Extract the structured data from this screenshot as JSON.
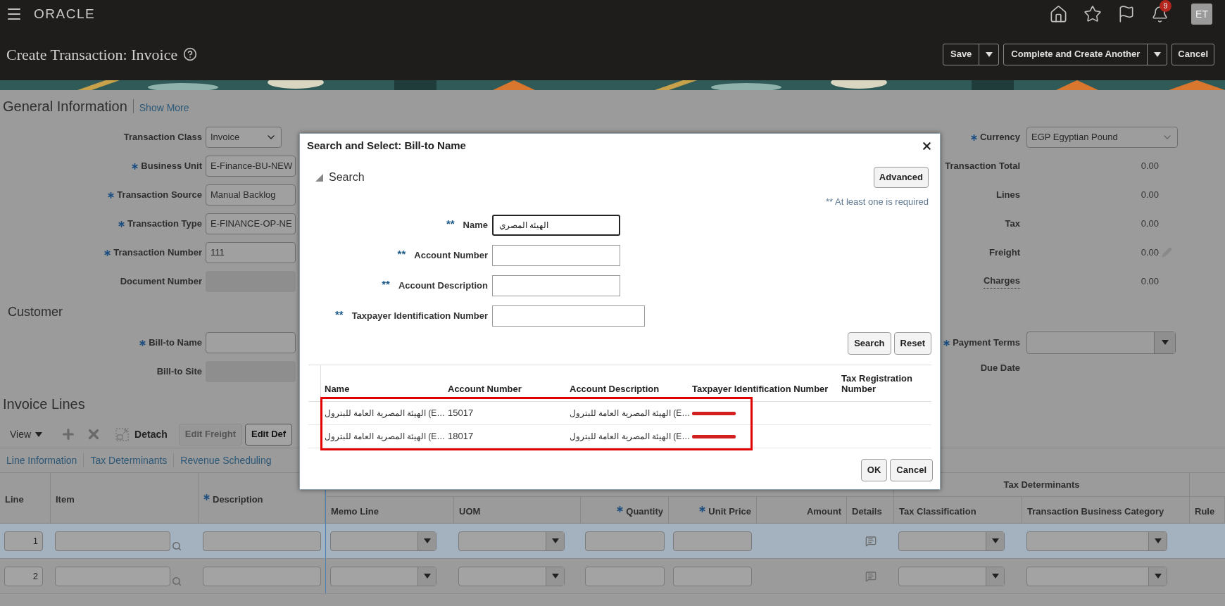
{
  "nav": {
    "logo": "ORACLE",
    "notification_count": "9",
    "avatar": "ET"
  },
  "page": {
    "title": "Create Transaction: Invoice"
  },
  "header_buttons": [
    {
      "label": "Save",
      "kind": "split"
    },
    {
      "label": "Complete and Create Another",
      "kind": "split"
    },
    {
      "label": "Cancel",
      "kind": "plain"
    }
  ],
  "general": {
    "heading": "General Information",
    "link": "Show More",
    "left_fields": [
      {
        "label": "Transaction Class",
        "required": false,
        "value": "Invoice",
        "kind": "select"
      },
      {
        "label": "Business Unit",
        "required": true,
        "value": "E-Finance-BU-NEW",
        "kind": "text"
      },
      {
        "label": "Transaction Source",
        "required": true,
        "value": "Manual Backlog",
        "kind": "text"
      },
      {
        "label": "Transaction Type",
        "required": true,
        "value": "E-FINANCE-OP-NE",
        "kind": "text"
      },
      {
        "label": "Transaction Number",
        "required": true,
        "value": "111",
        "kind": "text"
      },
      {
        "label": "Document Number",
        "required": false,
        "kind": "readonly"
      }
    ],
    "right_fields": [
      {
        "label": "Currency",
        "required": true,
        "value": "EGP Egyptian Pound",
        "kind": "select"
      },
      {
        "label": "Transaction Total",
        "required": false,
        "value": "0.00",
        "kind": "amount"
      },
      {
        "label": "Lines",
        "required": false,
        "value": "0.00",
        "kind": "amount"
      },
      {
        "label": "Tax",
        "required": false,
        "value": "0.00",
        "kind": "amount"
      },
      {
        "label": "Freight",
        "required": false,
        "value": "0.00",
        "kind": "editable_amount"
      },
      {
        "label": "Charges",
        "required": false,
        "value": "0.00",
        "kind": "link_amount"
      }
    ]
  },
  "customer": {
    "heading": "Customer",
    "left_fields": [
      {
        "label": "Bill-to Name",
        "required": true,
        "kind": "text"
      },
      {
        "label": "Bill-to Site",
        "required": false,
        "kind": "readonly"
      }
    ],
    "right_fields": [
      {
        "label": "Payment Terms",
        "required": true,
        "kind": "choice"
      },
      {
        "label": "Due Date",
        "required": false,
        "kind": "empty"
      }
    ]
  },
  "invoice_lines": {
    "heading": "Invoice Lines",
    "toolbar": [
      {
        "kind": "menu",
        "label": "View"
      },
      {
        "kind": "add"
      },
      {
        "kind": "delete"
      },
      {
        "kind": "detach",
        "label": "Detach"
      },
      {
        "kind": "button",
        "label": "Edit Freight",
        "disabled": true
      },
      {
        "kind": "button",
        "label": "Edit Def",
        "disabled": false
      }
    ],
    "tabs": [
      {
        "label": "Line Information"
      },
      {
        "label": "Tax Determinants"
      },
      {
        "label": "Revenue Scheduling"
      }
    ],
    "groups": [
      {
        "label": "Tax Determinants"
      }
    ],
    "columns": [
      {
        "label": "Line",
        "required": false,
        "kind": "line"
      },
      {
        "label": "Item",
        "required": false,
        "kind": "lookup"
      },
      {
        "label": "Description",
        "required": true,
        "kind": "text"
      },
      {
        "label": "Memo Line",
        "required": false,
        "kind": "choice"
      },
      {
        "label": "UOM",
        "required": false,
        "kind": "choice"
      },
      {
        "label": "Quantity",
        "required": true,
        "kind": "text"
      },
      {
        "label": "Unit Price",
        "required": true,
        "kind": "text"
      },
      {
        "label": "Amount",
        "required": false,
        "kind": "empty"
      },
      {
        "label": "Details",
        "required": false,
        "kind": "details"
      },
      {
        "label": "Tax Classification",
        "required": false,
        "kind": "choice"
      },
      {
        "label": "Transaction Business Category",
        "required": false,
        "kind": "choice"
      },
      {
        "label": "Rule",
        "required": false,
        "kind": "empty"
      }
    ],
    "rows": [
      {
        "line": "1",
        "selected": true
      },
      {
        "line": "2",
        "selected": false
      }
    ]
  },
  "dialog": {
    "title": "Search and Select: Bill-to Name",
    "section": "Search",
    "expanded": true,
    "advanced": "Advanced",
    "note": "** At least one is required",
    "fields": [
      {
        "marker": "**",
        "label": "Name",
        "value": "الهيئة المصري",
        "focused": true
      },
      {
        "marker": "**",
        "label": "Account Number",
        "focused": false
      },
      {
        "marker": "**",
        "label": "Account Description",
        "focused": false
      },
      {
        "marker": "**",
        "label": "Taxpayer Identification Number",
        "focused": false
      }
    ],
    "buttons": [
      "Search",
      "Reset"
    ],
    "columns": [
      "Name",
      "Account Number",
      "Account Description",
      "Taxpayer Identification Number",
      "Tax Registration Number"
    ],
    "rows": [
      {
        "name": "الهيئة المصرية العامة للبترول (E…",
        "account_number": "15017",
        "account_description": "الهيئة المصرية العامة للبترول (E…",
        "taxpayer_redacted": true
      },
      {
        "name": "الهيئة المصرية العامة للبترول (E…",
        "account_number": "18017",
        "account_description": "الهيئة المصرية العامة للبترول (E…",
        "taxpayer_redacted": true
      }
    ],
    "highlighted": true,
    "footer_buttons": [
      "OK",
      "Cancel"
    ]
  }
}
